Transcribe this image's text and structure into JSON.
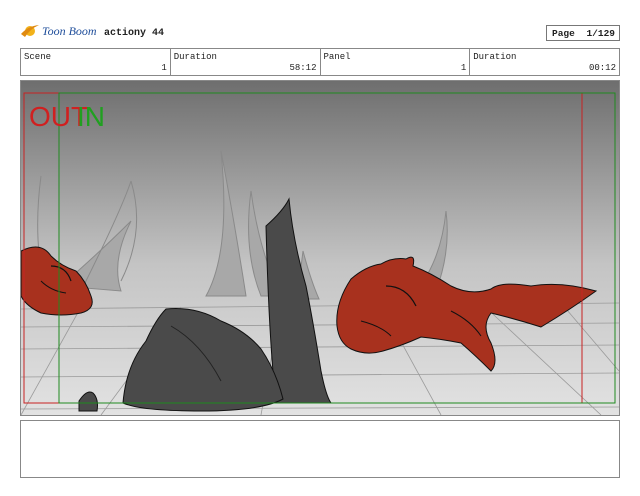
{
  "header": {
    "logo_text": "Toon Boom",
    "project_name": "actiony 44",
    "page_label": "Page",
    "page_value": "1/129"
  },
  "info": {
    "scene_label": "Scene",
    "scene_value": "1",
    "duration_label": "Duration",
    "duration_value": "58:12",
    "panel_label": "Panel",
    "panel_value": "1",
    "panel_duration_label": "Duration",
    "panel_duration_value": "00:12"
  },
  "panel": {
    "out_marker": "OUT",
    "in_marker": "IN",
    "colors": {
      "out_marker": "#d02020",
      "in_marker": "#20a020",
      "character_fill": "#a8311e",
      "rock_fill": "#4a4a4a"
    }
  },
  "notes": {
    "text": ""
  }
}
